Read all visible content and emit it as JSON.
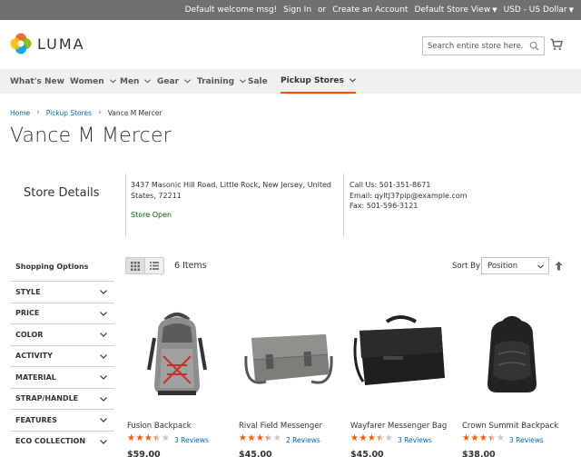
{
  "topbar": {
    "welcome": "Default welcome msg!",
    "sign_in": "Sign In",
    "or": "or",
    "create_account": "Create an Account",
    "store_view": "Default Store View",
    "currency": "USD - US Dollar"
  },
  "header": {
    "logo_text": "LUMA",
    "search_placeholder": "Search entire store here..."
  },
  "nav": [
    {
      "label": "What's New",
      "has_menu": false
    },
    {
      "label": "Women",
      "has_menu": true
    },
    {
      "label": "Men",
      "has_menu": true
    },
    {
      "label": "Gear",
      "has_menu": true
    },
    {
      "label": "Training",
      "has_menu": true
    },
    {
      "label": "Sale",
      "has_menu": false
    },
    {
      "label": "Pickup Stores",
      "has_menu": true,
      "active": true
    }
  ],
  "breadcrumb": {
    "home": "Home",
    "pickup": "Pickup Stores",
    "current": "Vance M Mercer"
  },
  "page_title": "Vance M Mercer",
  "store": {
    "label": "Store Details",
    "address": "3437 Masonic Hill Road, Little Rock, New Jersey, United States, 72211",
    "status": "Store Open",
    "phone": "Call Us: 501-351-8671",
    "email": "Email: qyltJ37pip@example.com",
    "fax": "Fax: 501-596-3121"
  },
  "sidebar": {
    "title": "Shopping Options",
    "filters": [
      "STYLE",
      "PRICE",
      "COLOR",
      "ACTIVITY",
      "MATERIAL",
      "STRAP/HANDLE",
      "FEATURES",
      "ECO COLLECTION"
    ]
  },
  "toolbar": {
    "count": "6 Items",
    "sort_label": "Sort By",
    "sort_value": "Position"
  },
  "products": [
    {
      "name": "Fusion Backpack",
      "rating": 0.7,
      "reviews": "3 Reviews",
      "price": "$59.00"
    },
    {
      "name": "Rival Field Messenger",
      "rating": 0.7,
      "reviews": "2 Reviews",
      "price": "$45.00"
    },
    {
      "name": "Wayfarer Messenger Bag",
      "rating": 0.7,
      "reviews": "3 Reviews",
      "price": "$45.00"
    },
    {
      "name": "Crown Summit Backpack",
      "rating": 0.7,
      "reviews": "3 Reviews",
      "price": "$38.00"
    }
  ],
  "colors": {
    "accent": "#ff5501",
    "link": "#006bb4",
    "topbar": "#6e716e",
    "nav": "#f0f0f0",
    "open": "#006400"
  },
  "star_glyphs": "★★★★★"
}
